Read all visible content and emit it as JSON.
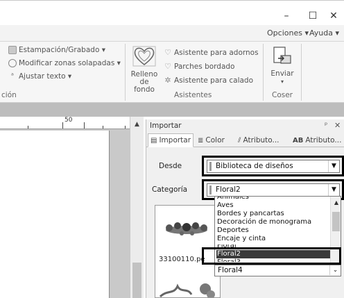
{
  "window": {
    "minimize": "–",
    "maximize": "☐",
    "close": "✕"
  },
  "ribbon_tabs": {
    "opciones": "Opciones ▾",
    "ayuda": "Ayuda ▾"
  },
  "ribbon": {
    "estampacion": "Estampación/Grabado ▾",
    "modificar": "Modificar zonas solapadas ▾",
    "ajustar": "Ajustar texto ▾",
    "group_left": "ción",
    "relleno_line1": "Relleno",
    "relleno_line2": "de fondo",
    "asistente_adornos": "Asistente para adornos",
    "parches": "Parches bordado",
    "asistente_calado": "Asistente para calado",
    "group_asistentes": "Asistentes",
    "enviar": "Enviar",
    "group_coser": "Coser"
  },
  "ruler": {
    "mark": "50"
  },
  "panel": {
    "title": "Importar",
    "pin": "ᵖ",
    "close": "✕",
    "tabs": {
      "importar": "Importar",
      "color": "Color",
      "atributo1": "Atributo...",
      "atributo2": "Atributo..."
    },
    "desde_label": "Desde",
    "desde_value": "Biblioteca de diseños",
    "categoria_label": "Categoría",
    "categoria_value": "Floral2",
    "preview_caption": "33100110.pe"
  },
  "dropdown": {
    "items": [
      "Animales",
      "Aves",
      "Bordes y pancartas",
      "Decoración de monograma",
      "Deportes",
      "Encaje y cinta",
      "Floral",
      "Floral2",
      "Floral3",
      "Floral4"
    ],
    "selected": "Floral2"
  },
  "colors": {
    "highlight": "#000000",
    "selected_bg": "#3a3a3a"
  }
}
